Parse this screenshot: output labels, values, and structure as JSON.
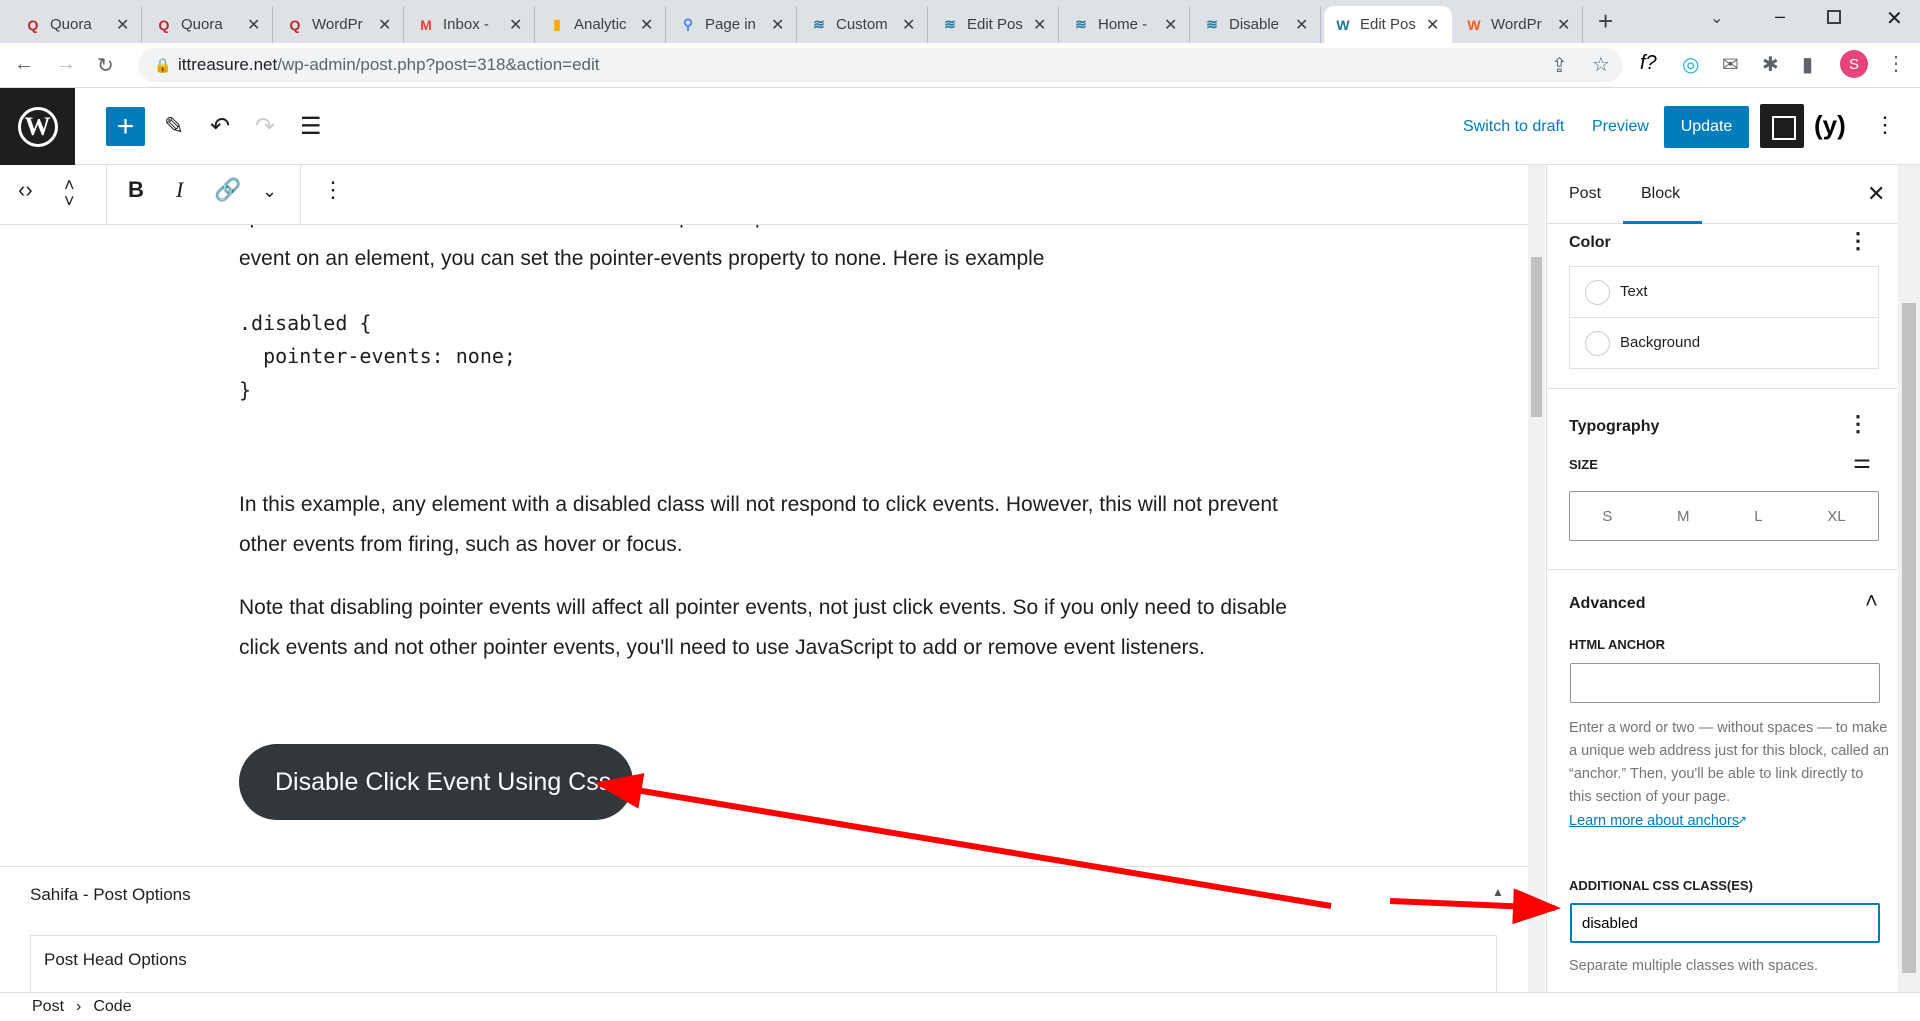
{
  "browser": {
    "tabs": [
      {
        "title": "Quora",
        "icon": "quora-icon",
        "color": "#b92b27",
        "glyph": "Q"
      },
      {
        "title": "Quora",
        "icon": "quora-icon",
        "color": "#b92b27",
        "glyph": "Q"
      },
      {
        "title": "WordPr",
        "icon": "quora-icon",
        "color": "#b92b27",
        "glyph": "Q"
      },
      {
        "title": "Inbox -",
        "icon": "gmail-icon",
        "color": "#ea4335",
        "glyph": "M"
      },
      {
        "title": "Analytic",
        "icon": "analytics-icon",
        "color": "#f9ab00",
        "glyph": "▮"
      },
      {
        "title": "Page in",
        "icon": "search-console-icon",
        "color": "#4285f4",
        "glyph": "⚲"
      },
      {
        "title": "Custom",
        "icon": "site-icon",
        "color": "#2a7a9b",
        "glyph": "≋"
      },
      {
        "title": "Edit Pos",
        "icon": "site-icon",
        "color": "#2a7a9b",
        "glyph": "≋"
      },
      {
        "title": "Home -",
        "icon": "site-icon",
        "color": "#2a7a9b",
        "glyph": "≋"
      },
      {
        "title": "Disable",
        "icon": "site-icon",
        "color": "#2a7a9b",
        "glyph": "≋"
      },
      {
        "title": "Edit Pos",
        "icon": "wordpress-icon",
        "color": "#21759b",
        "glyph": "W",
        "active": true
      },
      {
        "title": "WordPr",
        "icon": "wordpress-org-icon",
        "color": "#f05a22",
        "glyph": "W"
      }
    ],
    "url_host": "ittreasure.net",
    "url_path": "/wp-admin/post.php?post=318&action=edit",
    "profile_initial": "S"
  },
  "toolbar": {
    "switch_to_draft": "Switch to draft",
    "preview": "Preview",
    "update": "Update"
  },
  "content": {
    "partial_line": "specifies whether or not the element should respond to pointer events such as clicks. To disable the click",
    "line2": "event on an element, you can set the pointer-events property to none. Here is example",
    "code": [
      ".disabled {",
      "  pointer-events: none;",
      "}"
    ],
    "para1": "In this example, any element with a disabled class will not respond to click events. However, this will not prevent other events from firing, such as hover or focus.",
    "para2": "Note that disabling pointer events will affect all pointer events, not just click events. So if you only need to disable click events and not other pointer events, you'll need to use JavaScript to add or remove event listeners.",
    "button": "Disable Click Event Using Css"
  },
  "metabox": {
    "title": "Sahifa - Post Options",
    "sub": "Post Head Options"
  },
  "breadcrumb": [
    "Post",
    "Code"
  ],
  "sidebar": {
    "tabs": [
      "Post",
      "Block"
    ],
    "active_tab": "Block",
    "color": {
      "title": "Color",
      "items": [
        "Text",
        "Background"
      ]
    },
    "typography": {
      "title": "Typography",
      "size_label": "SIZE",
      "sizes": [
        "S",
        "M",
        "L",
        "XL"
      ]
    },
    "advanced": {
      "title": "Advanced",
      "anchor_label": "HTML ANCHOR",
      "anchor_value": "",
      "anchor_help": "Enter a word or two — without spaces — to make a unique web address just for this block, called an “anchor.” Then, you'll be able to link directly to this section of your page.",
      "anchor_link": "Learn more about anchors",
      "css_label": "ADDITIONAL CSS CLASS(ES)",
      "css_value": "disabled",
      "css_help": "Separate multiple classes with spaces."
    }
  },
  "annotation_color": "#ff0000"
}
